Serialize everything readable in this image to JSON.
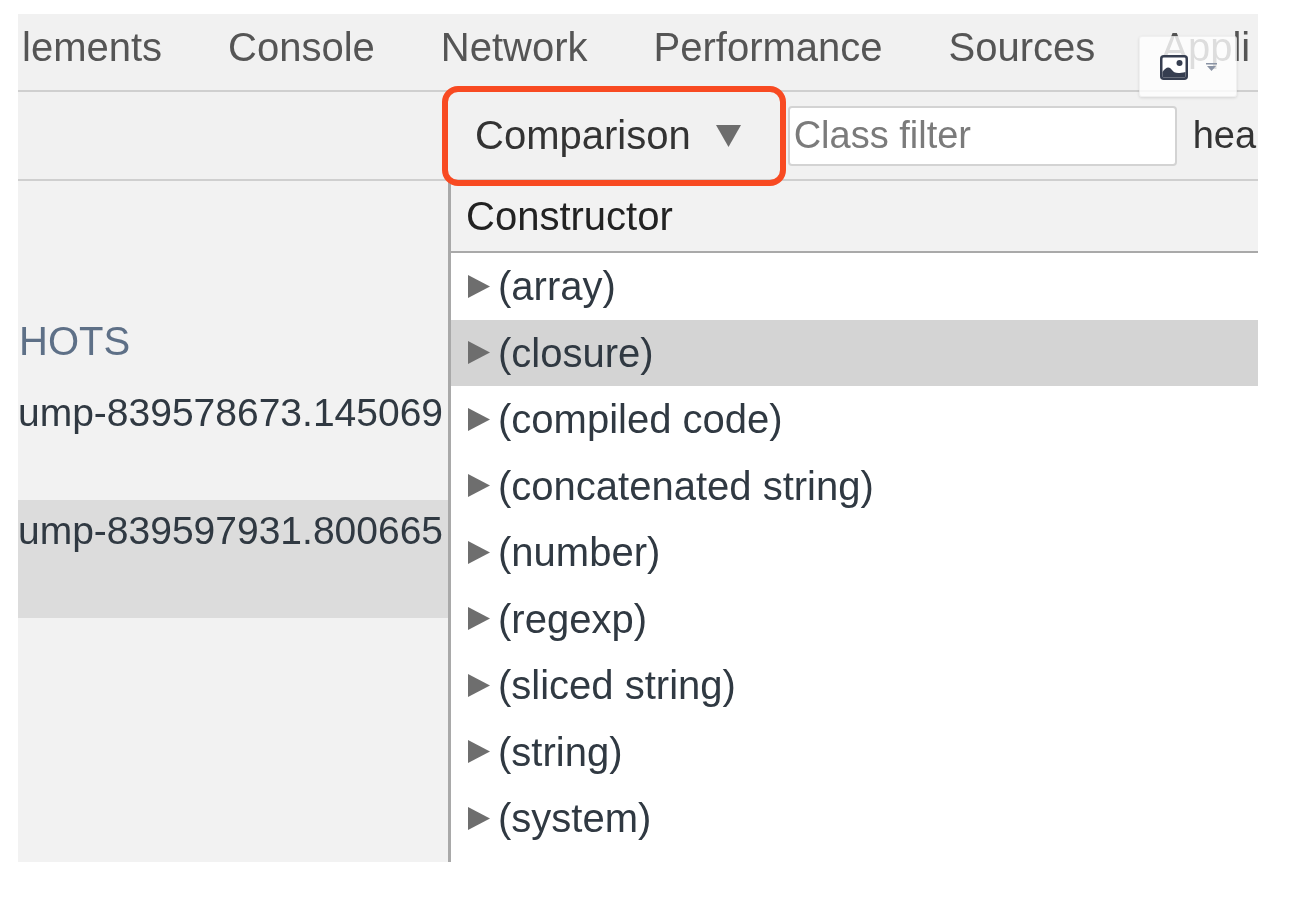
{
  "tabs": [
    {
      "label": "lements",
      "selected": false
    },
    {
      "label": "Console",
      "selected": false
    },
    {
      "label": "Network",
      "selected": false
    },
    {
      "label": "Performance",
      "selected": false
    },
    {
      "label": "Sources",
      "selected": false
    },
    {
      "label": "Appli",
      "selected": false
    }
  ],
  "toolbar": {
    "view_select": {
      "label": "Comparison",
      "highlighted": true
    },
    "class_filter": {
      "placeholder": "Class filter"
    },
    "label": "hea"
  },
  "sidebar": {
    "heading": "HOTS",
    "items": [
      {
        "name": "ump-839578673.145069",
        "selected": false
      },
      {
        "name": "ump-839597931.800665",
        "selected": true
      }
    ]
  },
  "table": {
    "columns": [
      "Constructor"
    ],
    "rows": [
      {
        "name": "(array)",
        "expanded": false,
        "selected": false
      },
      {
        "name": "(closure)",
        "expanded": false,
        "selected": true
      },
      {
        "name": "(compiled code)",
        "expanded": false,
        "selected": false
      },
      {
        "name": "(concatenated string)",
        "expanded": false,
        "selected": false
      },
      {
        "name": "(number)",
        "expanded": false,
        "selected": false
      },
      {
        "name": "(regexp)",
        "expanded": false,
        "selected": false
      },
      {
        "name": "(sliced string)",
        "expanded": false,
        "selected": false
      },
      {
        "name": "(string)",
        "expanded": false,
        "selected": false
      },
      {
        "name": "(system)",
        "expanded": false,
        "selected": false
      }
    ]
  }
}
